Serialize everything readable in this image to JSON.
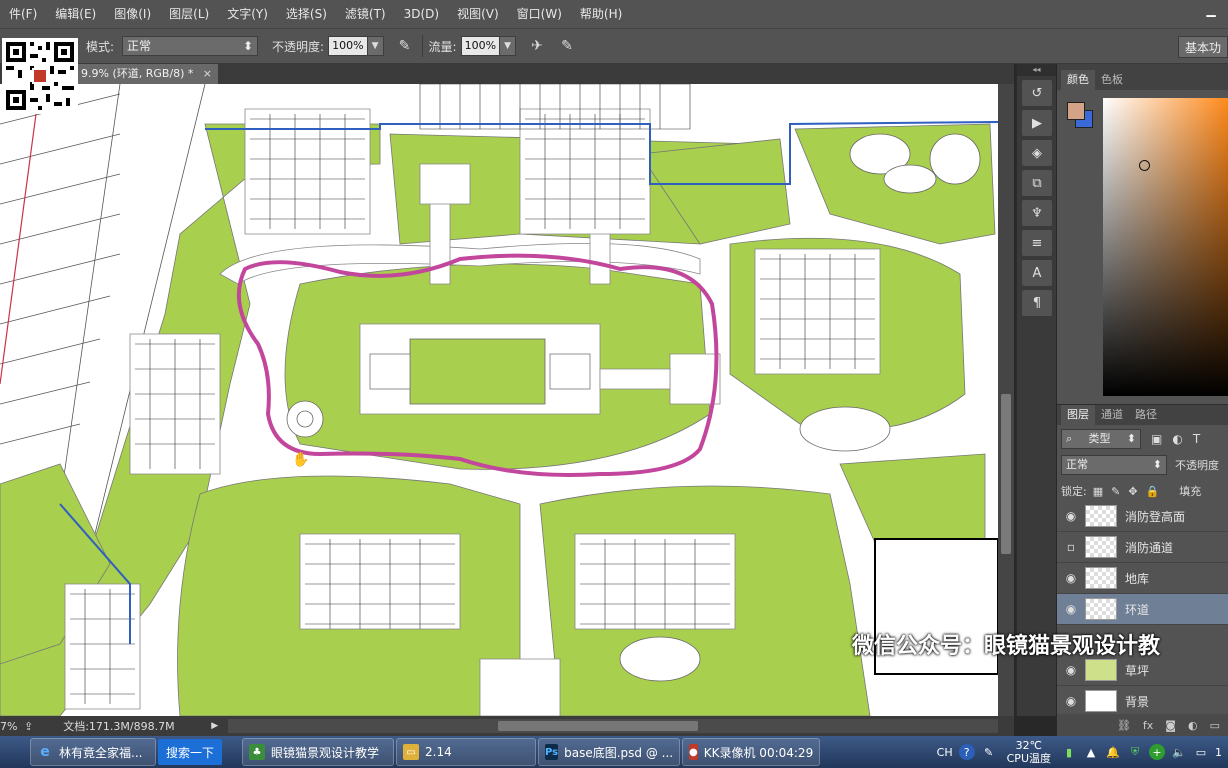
{
  "menubar": {
    "items": [
      "件(F)",
      "编辑(E)",
      "图像(I)",
      "图层(L)",
      "文字(Y)",
      "选择(S)",
      "滤镜(T)",
      "3D(D)",
      "视图(V)",
      "窗口(W)",
      "帮助(H)"
    ]
  },
  "options": {
    "mode_label": "模式:",
    "mode_value": "正常",
    "opacity_label": "不透明度:",
    "opacity_value": "100%",
    "flow_label": "流量:",
    "flow_value": "100%",
    "workspace_button": "基本功"
  },
  "document": {
    "tab_title": "9.9% (环道, RGB/8) *",
    "close_glyph": "×"
  },
  "status": {
    "zoom": "7%",
    "doc_size": "文档:171.3M/898.7M"
  },
  "color_panel": {
    "tabs": [
      "颜色",
      "色板"
    ]
  },
  "layers_panel": {
    "tabs": [
      "图层",
      "通道",
      "路径"
    ],
    "filter_kind": "类型",
    "blend_mode": "正常",
    "opacity_label": "不透明度",
    "lock_label": "锁定:",
    "fill_label": "填充",
    "layers": [
      {
        "name": "消防登高面",
        "visible": true,
        "selected": false
      },
      {
        "name": "消防通道",
        "visible": false,
        "selected": false
      },
      {
        "name": "地库",
        "visible": true,
        "selected": false
      },
      {
        "name": "环道",
        "visible": true,
        "selected": true
      },
      {
        "name": "草坪",
        "visible": true,
        "selected": false
      },
      {
        "name": "背景",
        "visible": true,
        "selected": false
      }
    ]
  },
  "watermark": "微信公众号：眼镜猫景观设计教",
  "taskbar": {
    "tasks": [
      {
        "label": "林有竟全家福...",
        "icon": "ie-icon"
      },
      {
        "label": "搜索一下",
        "icon": ""
      },
      {
        "label": "眼镜猫景观设计教学",
        "icon": "tree-icon"
      },
      {
        "label": "2.14",
        "icon": "folder-icon"
      },
      {
        "label": "base底图.psd @ ...",
        "icon": "ps-icon"
      },
      {
        "label": "KK录像机 00:04:29",
        "icon": "record-icon"
      }
    ],
    "ime": "CH",
    "temp": "32℃",
    "temp_label": "CPU温度",
    "clock": "1"
  }
}
